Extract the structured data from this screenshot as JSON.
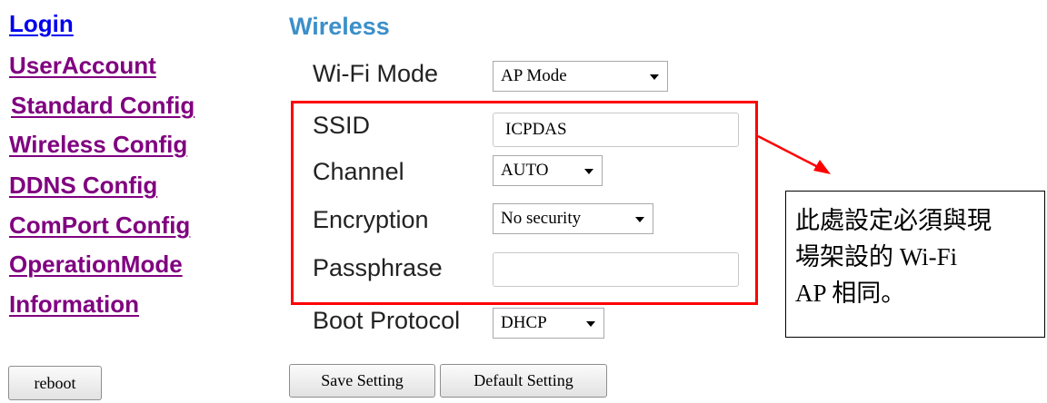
{
  "nav": {
    "items": [
      {
        "label": "Login"
      },
      {
        "label": "UserAccount"
      },
      {
        "label": "Standard Config"
      },
      {
        "label": "Wireless Config"
      },
      {
        "label": "DDNS Config"
      },
      {
        "label": "ComPort Config"
      },
      {
        "label": "OperationMode"
      },
      {
        "label": "Information"
      }
    ],
    "reboot_label": "reboot"
  },
  "wireless": {
    "title": "Wireless",
    "wifi_mode": {
      "label": "Wi-Fi Mode",
      "value": "AP Mode"
    },
    "ssid": {
      "label": "SSID",
      "value": "ICPDAS"
    },
    "channel": {
      "label": "Channel",
      "value": "AUTO"
    },
    "encryption": {
      "label": "Encryption",
      "value": "No security"
    },
    "passphrase": {
      "label": "Passphrase",
      "value": ""
    },
    "boot_protocol": {
      "label": "Boot Protocol",
      "value": "DHCP"
    },
    "save_label": "Save Setting",
    "default_label": "Default Setting"
  },
  "annotation": {
    "lines": [
      "此處設定必須與現",
      "場架設的 Wi-Fi",
      "AP  相同。"
    ],
    "highlight_color": "#ff0000"
  }
}
